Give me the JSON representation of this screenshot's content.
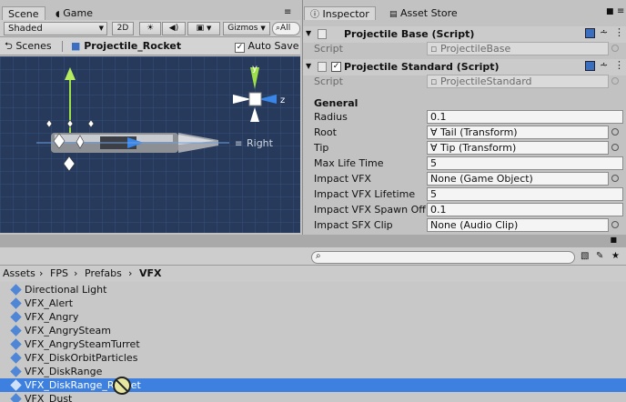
{
  "scene_tabs": {
    "scene": "Scene",
    "game": "Game"
  },
  "scene_toolbar": {
    "shading": "Shaded",
    "mode_2d": "2D",
    "gizmos": "Gizmos",
    "search_prefix": "All"
  },
  "scene_breadcrumb": {
    "scenes": "Scenes",
    "prefab": "Projectile_Rocket",
    "auto_save": "Auto Save"
  },
  "scene_view": {
    "orientation_label": "Right",
    "axis_y": "y",
    "axis_z": "z"
  },
  "inspector_tabs": {
    "inspector": "Inspector",
    "asset_store": "Asset Store"
  },
  "components": [
    {
      "title": "Projectile Base (Script)",
      "script_label": "Script",
      "script_value": "ProjectileBase"
    },
    {
      "title": "Projectile Standard (Script)",
      "script_label": "Script",
      "script_value": "ProjectileStandard"
    }
  ],
  "general": {
    "header": "General",
    "fields": [
      {
        "label": "Radius",
        "value": "0.1"
      },
      {
        "label": "Root",
        "value": "Tail (Transform)"
      },
      {
        "label": "Tip",
        "value": "Tip (Transform)"
      },
      {
        "label": "Max Life Time",
        "value": "5"
      },
      {
        "label": "Impact VFX",
        "value": "None (Game Object)"
      },
      {
        "label": "Impact VFX Lifetime",
        "value": "5"
      },
      {
        "label": "Impact VFX Spawn Off",
        "value": "0.1"
      },
      {
        "label": "Impact SFX Clip",
        "value": "None (Audio Clip)"
      }
    ]
  },
  "project": {
    "breadcrumb": [
      "Assets",
      "FPS",
      "Prefabs",
      "VFX"
    ],
    "items": [
      "Directional Light",
      "VFX_Alert",
      "VFX_Angry",
      "VFX_AngrySteam",
      "VFX_AngrySteamTurret",
      "VFX_DiskOrbitParticles",
      "VFX_DiskRange",
      "VFX_DiskRange_Rocket",
      "VFX_Dust"
    ],
    "selected_index": 7
  },
  "colors": {
    "scene_bg": "#273a5c",
    "grid": "#35507c",
    "selection": "#3d80df",
    "panel": "#c2c2c2"
  }
}
